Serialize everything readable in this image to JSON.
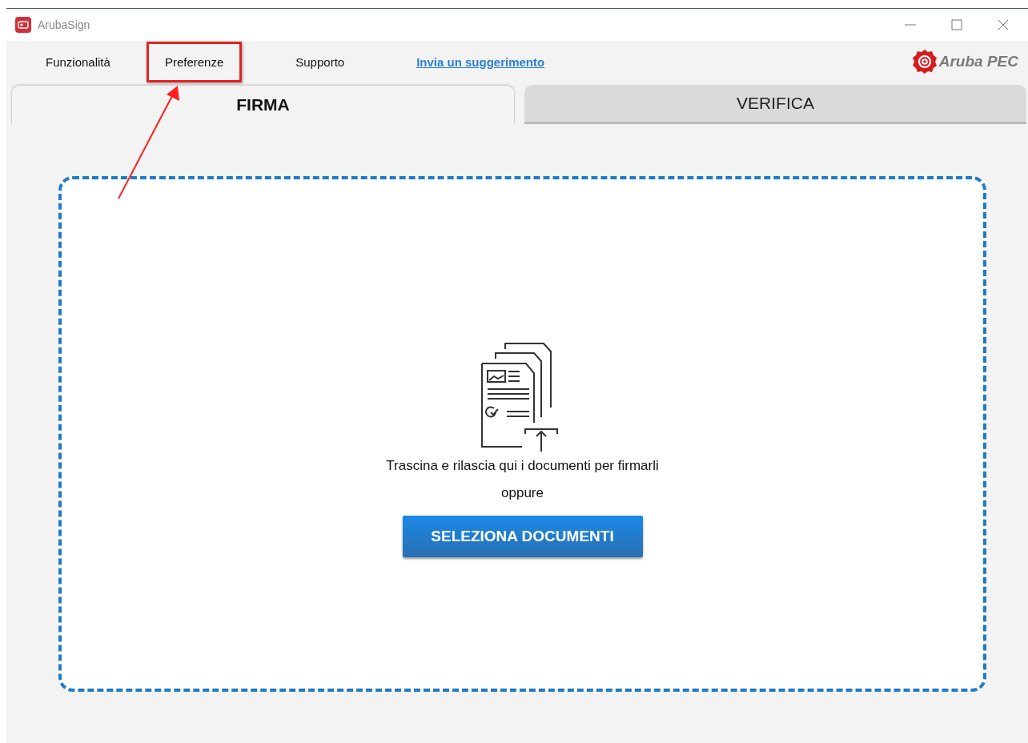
{
  "window": {
    "title": "ArubaSign"
  },
  "menu": [
    {
      "label": "Funzionalità",
      "kind": "item",
      "highlighted": false
    },
    {
      "label": "Preferenze",
      "kind": "item",
      "highlighted": true
    },
    {
      "label": "Supporto",
      "kind": "item",
      "highlighted": false
    },
    {
      "label": "Invia un suggerimento",
      "kind": "link",
      "highlighted": false
    }
  ],
  "logo": {
    "text": "Aruba PEC"
  },
  "tabs": [
    {
      "label": "FIRMA",
      "selected": true
    },
    {
      "label": "VERIFICA",
      "selected": false
    }
  ],
  "drop_zone": {
    "instruction": "Trascina e rilascia qui i documenti per firmarli",
    "separator": "oppure",
    "button": "SELEZIONA DOCUMENTI"
  }
}
